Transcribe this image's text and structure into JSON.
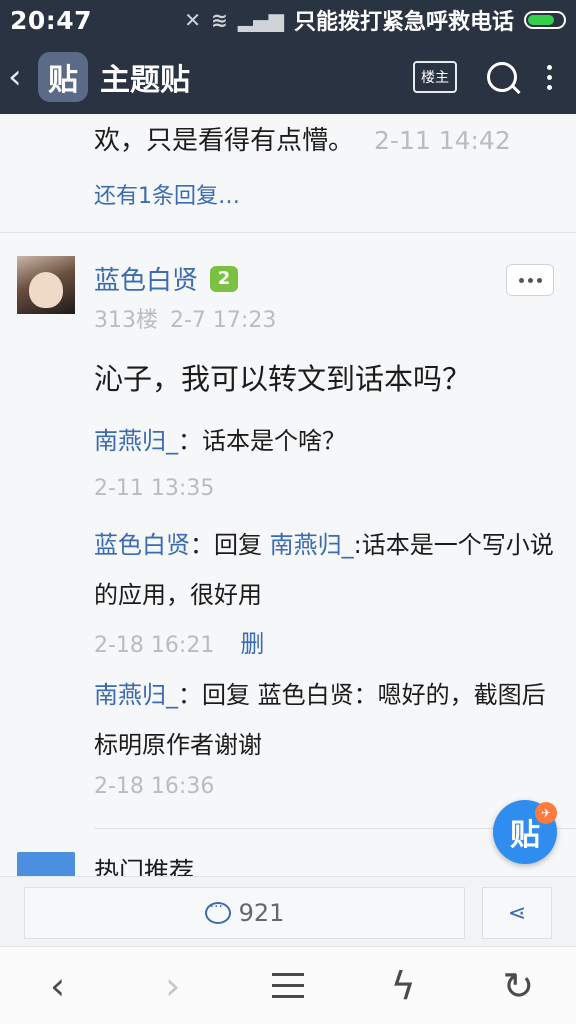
{
  "status_bar": {
    "time": "20:47",
    "carrier_text": "只能拨打紧急呼救电话",
    "icons": [
      "mute-icon",
      "wifi-icon",
      "signal-icon",
      "battery-icon"
    ]
  },
  "nav": {
    "back_icon": "‹",
    "logo_text": "贴",
    "title": "主题贴",
    "louzhu_label": "楼主"
  },
  "previous_reply": {
    "text": "欢，只是看得有点懵。",
    "time": "2-11 14:42"
  },
  "more_replies_label": "还有1条回复…",
  "post": {
    "author": "蓝色白贤",
    "level": "2",
    "floor": "313楼",
    "time": "2-7 17:23",
    "body": "沁子，我可以转文到话本吗？",
    "replies": [
      {
        "name": "南燕归_",
        "sep": "：",
        "text": "话本是个啥？",
        "time": "2-11 13:35"
      },
      {
        "name": "蓝色白贤",
        "sep": "：",
        "reply_prefix": "回复",
        "reply_to": "南燕归_",
        "text": ":话本是一个写小说的应用，很好用",
        "time": "2-18 16:21",
        "delete_label": "删"
      },
      {
        "name": "南燕归_",
        "sep": "：",
        "reply_prefix": "回复",
        "reply_to": "蓝色白贤",
        "text": "：嗯好的，截图后标明原作者谢谢",
        "time": "2-18 16:36"
      }
    ]
  },
  "hot": {
    "title": "热门推荐"
  },
  "float_button": {
    "label": "贴"
  },
  "action_bar": {
    "comment_count": "921"
  },
  "toolbar": {
    "back": "‹",
    "forward": "›",
    "refresh": "↻",
    "flash": "ϟ"
  },
  "colors": {
    "nav_bg": "#2a3342",
    "link": "#3b6bb0",
    "timestamp": "#b8bcc3",
    "level_badge": "#7ac143",
    "float_button": "#2f8df0"
  }
}
